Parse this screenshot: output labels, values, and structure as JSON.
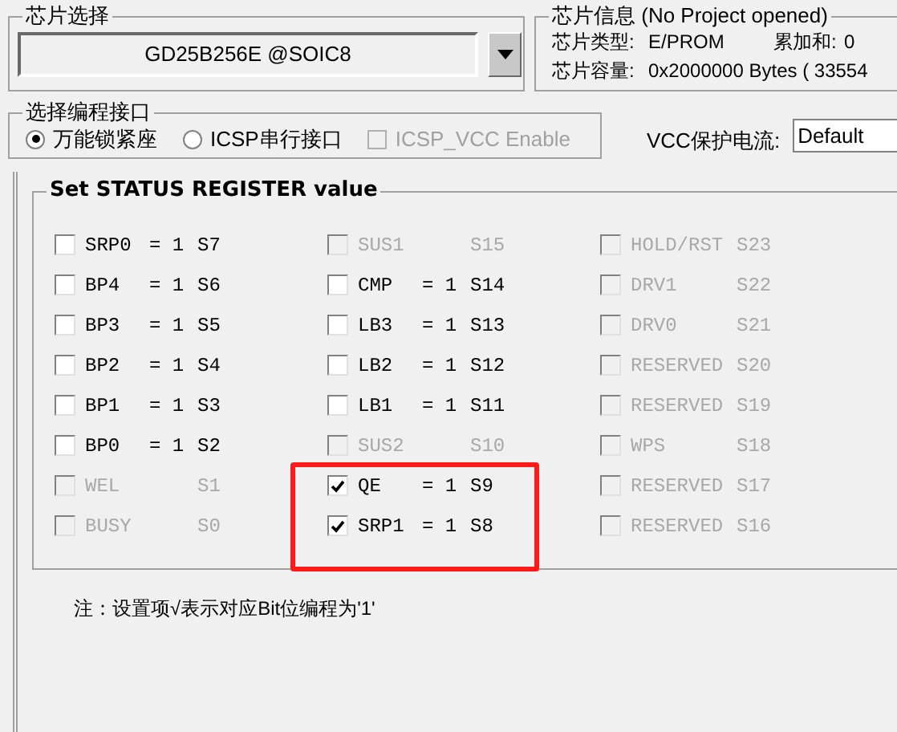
{
  "chip_select": {
    "title": "芯片选择",
    "value": "GD25B256E @SOIC8"
  },
  "chip_info": {
    "title": "芯片信息 (No Project opened)",
    "rows": [
      {
        "label": "芯片类型:",
        "value": "E/PROM",
        "extra_label": "累加和:",
        "extra_value": "0"
      },
      {
        "label": "芯片容量:",
        "value": "0x2000000 Bytes ( 33554"
      }
    ]
  },
  "interface": {
    "title": "选择编程接口",
    "options": [
      {
        "label": "万能锁紧座",
        "selected": true
      },
      {
        "label": "ICSP串行接口",
        "selected": false
      }
    ],
    "vcc_enable": {
      "label": "ICSP_VCC Enable",
      "checked": false,
      "disabled": true
    }
  },
  "vcc_protect": {
    "label": "VCC保护电流:",
    "value": "Default"
  },
  "status_register": {
    "title": "Set STATUS REGISTER value",
    "columns": [
      [
        {
          "name": "SRP0",
          "value": "= 1",
          "bit": "S7",
          "checked": false,
          "disabled": false
        },
        {
          "name": "BP4",
          "value": "= 1",
          "bit": "S6",
          "checked": false,
          "disabled": false
        },
        {
          "name": "BP3",
          "value": "= 1",
          "bit": "S5",
          "checked": false,
          "disabled": false
        },
        {
          "name": "BP2",
          "value": "= 1",
          "bit": "S4",
          "checked": false,
          "disabled": false
        },
        {
          "name": "BP1",
          "value": "= 1",
          "bit": "S3",
          "checked": false,
          "disabled": false
        },
        {
          "name": "BP0",
          "value": "= 1",
          "bit": "S2",
          "checked": false,
          "disabled": false
        },
        {
          "name": "WEL",
          "bit": "S1",
          "checked": false,
          "disabled": true
        },
        {
          "name": "BUSY",
          "bit": "S0",
          "checked": false,
          "disabled": true
        }
      ],
      [
        {
          "name": "SUS1",
          "bit": "S15",
          "checked": false,
          "disabled": true
        },
        {
          "name": "CMP",
          "value": "= 1",
          "bit": "S14",
          "checked": false,
          "disabled": false
        },
        {
          "name": "LB3",
          "value": "= 1",
          "bit": "S13",
          "checked": false,
          "disabled": false
        },
        {
          "name": "LB2",
          "value": "= 1",
          "bit": "S12",
          "checked": false,
          "disabled": false
        },
        {
          "name": "LB1",
          "value": "= 1",
          "bit": "S11",
          "checked": false,
          "disabled": false
        },
        {
          "name": "SUS2",
          "bit": "S10",
          "checked": false,
          "disabled": true
        },
        {
          "name": "QE",
          "value": "= 1",
          "bit": "S9",
          "checked": true,
          "disabled": false
        },
        {
          "name": "SRP1",
          "value": "= 1",
          "bit": "S8",
          "checked": true,
          "disabled": false
        }
      ],
      [
        {
          "name": "HOLD/RST",
          "bit": "S23",
          "checked": false,
          "disabled": true
        },
        {
          "name": "DRV1",
          "bit": "S22",
          "checked": false,
          "disabled": true
        },
        {
          "name": "DRV0",
          "bit": "S21",
          "checked": false,
          "disabled": true
        },
        {
          "name": "RESERVED",
          "bit": "S20",
          "checked": false,
          "disabled": true
        },
        {
          "name": "RESERVED",
          "bit": "S19",
          "checked": false,
          "disabled": true
        },
        {
          "name": "WPS",
          "bit": "S18",
          "checked": false,
          "disabled": true
        },
        {
          "name": "RESERVED",
          "bit": "S17",
          "checked": false,
          "disabled": true
        },
        {
          "name": "RESERVED",
          "bit": "S16",
          "checked": false,
          "disabled": true
        }
      ]
    ]
  },
  "note": "注：设置项√表示对应Bit位编程为'1'"
}
